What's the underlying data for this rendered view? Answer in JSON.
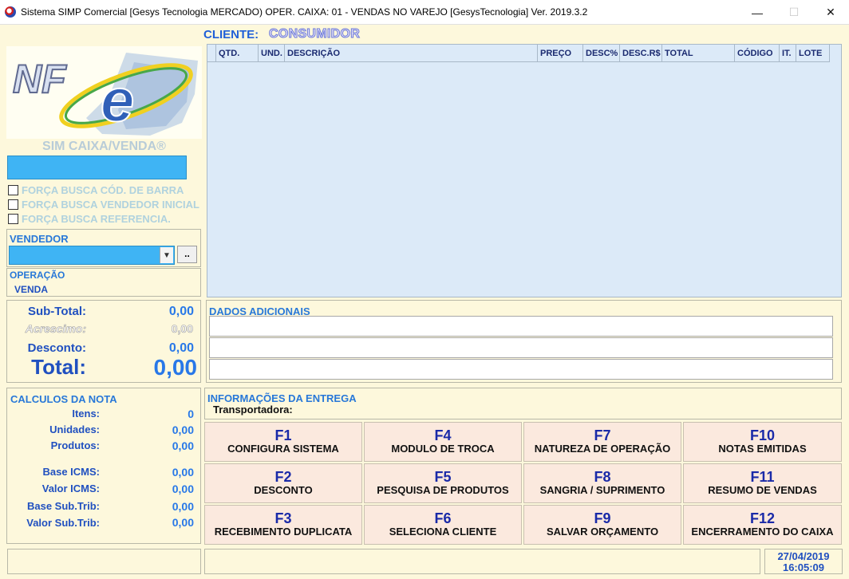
{
  "window": {
    "title": "Sistema SIMP Comercial [Gesys Tecnologia MERCADO)  OPER. CAIXA: 01  - VENDAS NO VAREJO  [GesysTecnologia]  Ver. 2019.3.2",
    "minimize_glyph": "—",
    "maximize_glyph": "☐",
    "close_glyph": "✕"
  },
  "cliente": {
    "label": "CLIENTE:",
    "value": "CONSUMIDOR"
  },
  "logo": {
    "text": "NF",
    "letter": "e"
  },
  "brand_title": "SIM CAIXA/VENDA®",
  "checkboxes": [
    {
      "label": "FORÇA BUSCA CÓD. DE BARRA",
      "checked": false
    },
    {
      "label": "FORÇA BUSCA VENDEDOR INICIAL",
      "checked": false
    },
    {
      "label": "FORÇA BUSCA REFERENCIA.",
      "checked": false
    }
  ],
  "vendedor": {
    "label": "VENDEDOR",
    "value": "",
    "button_label": ".."
  },
  "operacao": {
    "label": "OPERAÇÃO",
    "value": "VENDA"
  },
  "grid": {
    "columns": [
      "QTD.",
      "UND.",
      "DESCRIÇÃO",
      "PREÇO",
      "DESC%",
      "DESC.R$",
      "TOTAL",
      "CÓDIGO",
      "IT.",
      "LOTE"
    ]
  },
  "totals": {
    "subtotal_label": "Sub-Total:",
    "subtotal_value": "0,00",
    "acrescimo_label": "Acrescimo:",
    "acrescimo_value": "0,00",
    "desconto_label": "Desconto:",
    "desconto_value": "0,00",
    "total_label": "Total:",
    "total_value": "0,00"
  },
  "dados_adicionais": {
    "label": "DADOS ADICIONAIS",
    "lines": [
      "",
      "",
      ""
    ]
  },
  "calculos": {
    "label": "CALCULOS DA NOTA",
    "rows": [
      {
        "label": "Itens:",
        "value": "0"
      },
      {
        "label": "Unidades:",
        "value": "0,00"
      },
      {
        "label": "Produtos:",
        "value": "0,00"
      },
      {
        "label": "Base ICMS:",
        "value": "0,00"
      },
      {
        "label": "Valor ICMS:",
        "value": "0,00"
      },
      {
        "label": "Base Sub.Trib:",
        "value": "0,00"
      },
      {
        "label": "Valor Sub.Trib:",
        "value": "0,00"
      }
    ]
  },
  "entrega": {
    "label": "INFORMAÇÕES DA ENTREGA",
    "transportadora_label": "Transportadora:"
  },
  "fkeys": [
    {
      "key": "F1",
      "label": "CONFIGURA SISTEMA"
    },
    {
      "key": "F4",
      "label": "MODULO DE TROCA"
    },
    {
      "key": "F7",
      "label": "NATUREZA DE OPERAÇÃO"
    },
    {
      "key": "F10",
      "label": "NOTAS EMITIDAS"
    },
    {
      "key": "F2",
      "label": "DESCONTO"
    },
    {
      "key": "F5",
      "label": "PESQUISA DE PRODUTOS"
    },
    {
      "key": "F8",
      "label": "SANGRIA / SUPRIMENTO"
    },
    {
      "key": "F11",
      "label": "RESUMO DE VENDAS"
    },
    {
      "key": "F3",
      "label": "RECEBIMENTO DUPLICATA"
    },
    {
      "key": "F6",
      "label": "SELECIONA CLIENTE"
    },
    {
      "key": "F9",
      "label": "SALVAR ORÇAMENTO"
    },
    {
      "key": "F12",
      "label": "ENCERRAMENTO DO CAIXA"
    }
  ],
  "status": {
    "left": "",
    "middle": "",
    "date": "27/04/2019",
    "time": "16:05:09"
  },
  "colors": {
    "accent": "#2878e8",
    "input_blue": "#3fb4f4",
    "grid_bg": "#dceaf8",
    "panel_bg": "#fdf8dc",
    "fkey_bg": "#fbe9de"
  }
}
